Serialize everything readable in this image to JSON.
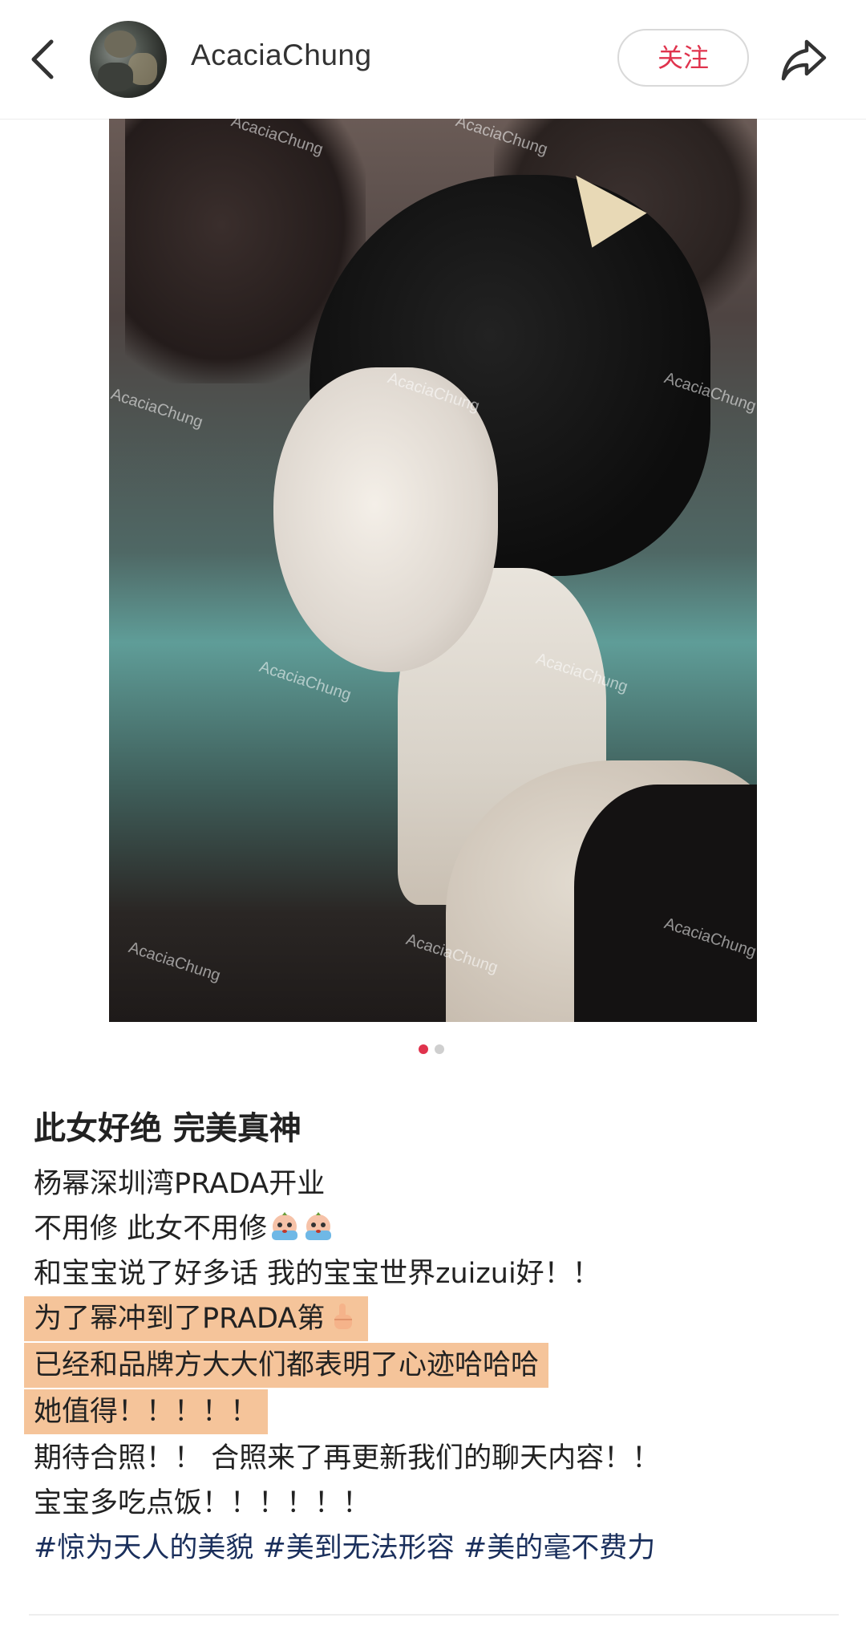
{
  "topbar": {
    "username": "AcaciaChung",
    "follow_label": "关注",
    "back_icon": "chevron-left-icon",
    "share_icon": "share-arrow-icon"
  },
  "photo": {
    "watermark_text": "AcaciaChung",
    "carousel_count": 2,
    "carousel_active": 1
  },
  "post": {
    "title": "此女好绝 完美真神",
    "lines": [
      "杨幂深圳湾PRADA开业",
      "不用修 此女不用修",
      "和宝宝说了好多话 我的宝宝世界zuizui好！！",
      "为了幂冲到了PRADA第",
      "已经和品牌方大大们都表明了心迹哈哈哈",
      "她值得！！！！！",
      "期待合照！！ 合照来了再更新我们的聊天内容！！",
      "宝宝多吃点饭！！！！！！",
      "#惊为天人的美貌 #美到无法形容 #美的毫不费力"
    ],
    "emojis": [
      "crying-baby-emoji",
      "crying-baby-emoji",
      "index-pointing-up-emoji"
    ]
  },
  "colors": {
    "accent": "#e0334d",
    "highlight": "#f5c49a",
    "tag": "#1a2f5c"
  }
}
